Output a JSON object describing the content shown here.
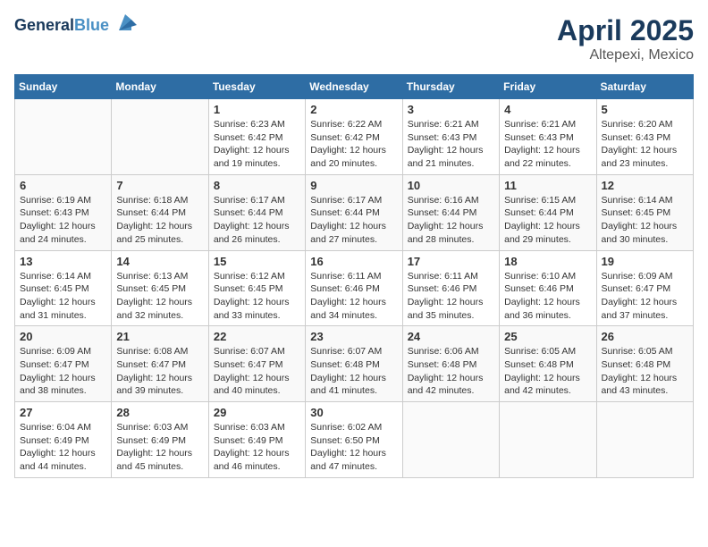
{
  "header": {
    "logo_line1": "General",
    "logo_line2": "Blue",
    "title": "April 2025",
    "subtitle": "Altepexi, Mexico"
  },
  "weekdays": [
    "Sunday",
    "Monday",
    "Tuesday",
    "Wednesday",
    "Thursday",
    "Friday",
    "Saturday"
  ],
  "weeks": [
    [
      {
        "day": "",
        "sunrise": "",
        "sunset": "",
        "daylight": ""
      },
      {
        "day": "",
        "sunrise": "",
        "sunset": "",
        "daylight": ""
      },
      {
        "day": "1",
        "sunrise": "Sunrise: 6:23 AM",
        "sunset": "Sunset: 6:42 PM",
        "daylight": "Daylight: 12 hours and 19 minutes."
      },
      {
        "day": "2",
        "sunrise": "Sunrise: 6:22 AM",
        "sunset": "Sunset: 6:42 PM",
        "daylight": "Daylight: 12 hours and 20 minutes."
      },
      {
        "day": "3",
        "sunrise": "Sunrise: 6:21 AM",
        "sunset": "Sunset: 6:43 PM",
        "daylight": "Daylight: 12 hours and 21 minutes."
      },
      {
        "day": "4",
        "sunrise": "Sunrise: 6:21 AM",
        "sunset": "Sunset: 6:43 PM",
        "daylight": "Daylight: 12 hours and 22 minutes."
      },
      {
        "day": "5",
        "sunrise": "Sunrise: 6:20 AM",
        "sunset": "Sunset: 6:43 PM",
        "daylight": "Daylight: 12 hours and 23 minutes."
      }
    ],
    [
      {
        "day": "6",
        "sunrise": "Sunrise: 6:19 AM",
        "sunset": "Sunset: 6:43 PM",
        "daylight": "Daylight: 12 hours and 24 minutes."
      },
      {
        "day": "7",
        "sunrise": "Sunrise: 6:18 AM",
        "sunset": "Sunset: 6:44 PM",
        "daylight": "Daylight: 12 hours and 25 minutes."
      },
      {
        "day": "8",
        "sunrise": "Sunrise: 6:17 AM",
        "sunset": "Sunset: 6:44 PM",
        "daylight": "Daylight: 12 hours and 26 minutes."
      },
      {
        "day": "9",
        "sunrise": "Sunrise: 6:17 AM",
        "sunset": "Sunset: 6:44 PM",
        "daylight": "Daylight: 12 hours and 27 minutes."
      },
      {
        "day": "10",
        "sunrise": "Sunrise: 6:16 AM",
        "sunset": "Sunset: 6:44 PM",
        "daylight": "Daylight: 12 hours and 28 minutes."
      },
      {
        "day": "11",
        "sunrise": "Sunrise: 6:15 AM",
        "sunset": "Sunset: 6:44 PM",
        "daylight": "Daylight: 12 hours and 29 minutes."
      },
      {
        "day": "12",
        "sunrise": "Sunrise: 6:14 AM",
        "sunset": "Sunset: 6:45 PM",
        "daylight": "Daylight: 12 hours and 30 minutes."
      }
    ],
    [
      {
        "day": "13",
        "sunrise": "Sunrise: 6:14 AM",
        "sunset": "Sunset: 6:45 PM",
        "daylight": "Daylight: 12 hours and 31 minutes."
      },
      {
        "day": "14",
        "sunrise": "Sunrise: 6:13 AM",
        "sunset": "Sunset: 6:45 PM",
        "daylight": "Daylight: 12 hours and 32 minutes."
      },
      {
        "day": "15",
        "sunrise": "Sunrise: 6:12 AM",
        "sunset": "Sunset: 6:45 PM",
        "daylight": "Daylight: 12 hours and 33 minutes."
      },
      {
        "day": "16",
        "sunrise": "Sunrise: 6:11 AM",
        "sunset": "Sunset: 6:46 PM",
        "daylight": "Daylight: 12 hours and 34 minutes."
      },
      {
        "day": "17",
        "sunrise": "Sunrise: 6:11 AM",
        "sunset": "Sunset: 6:46 PM",
        "daylight": "Daylight: 12 hours and 35 minutes."
      },
      {
        "day": "18",
        "sunrise": "Sunrise: 6:10 AM",
        "sunset": "Sunset: 6:46 PM",
        "daylight": "Daylight: 12 hours and 36 minutes."
      },
      {
        "day": "19",
        "sunrise": "Sunrise: 6:09 AM",
        "sunset": "Sunset: 6:47 PM",
        "daylight": "Daylight: 12 hours and 37 minutes."
      }
    ],
    [
      {
        "day": "20",
        "sunrise": "Sunrise: 6:09 AM",
        "sunset": "Sunset: 6:47 PM",
        "daylight": "Daylight: 12 hours and 38 minutes."
      },
      {
        "day": "21",
        "sunrise": "Sunrise: 6:08 AM",
        "sunset": "Sunset: 6:47 PM",
        "daylight": "Daylight: 12 hours and 39 minutes."
      },
      {
        "day": "22",
        "sunrise": "Sunrise: 6:07 AM",
        "sunset": "Sunset: 6:47 PM",
        "daylight": "Daylight: 12 hours and 40 minutes."
      },
      {
        "day": "23",
        "sunrise": "Sunrise: 6:07 AM",
        "sunset": "Sunset: 6:48 PM",
        "daylight": "Daylight: 12 hours and 41 minutes."
      },
      {
        "day": "24",
        "sunrise": "Sunrise: 6:06 AM",
        "sunset": "Sunset: 6:48 PM",
        "daylight": "Daylight: 12 hours and 42 minutes."
      },
      {
        "day": "25",
        "sunrise": "Sunrise: 6:05 AM",
        "sunset": "Sunset: 6:48 PM",
        "daylight": "Daylight: 12 hours and 42 minutes."
      },
      {
        "day": "26",
        "sunrise": "Sunrise: 6:05 AM",
        "sunset": "Sunset: 6:48 PM",
        "daylight": "Daylight: 12 hours and 43 minutes."
      }
    ],
    [
      {
        "day": "27",
        "sunrise": "Sunrise: 6:04 AM",
        "sunset": "Sunset: 6:49 PM",
        "daylight": "Daylight: 12 hours and 44 minutes."
      },
      {
        "day": "28",
        "sunrise": "Sunrise: 6:03 AM",
        "sunset": "Sunset: 6:49 PM",
        "daylight": "Daylight: 12 hours and 45 minutes."
      },
      {
        "day": "29",
        "sunrise": "Sunrise: 6:03 AM",
        "sunset": "Sunset: 6:49 PM",
        "daylight": "Daylight: 12 hours and 46 minutes."
      },
      {
        "day": "30",
        "sunrise": "Sunrise: 6:02 AM",
        "sunset": "Sunset: 6:50 PM",
        "daylight": "Daylight: 12 hours and 47 minutes."
      },
      {
        "day": "",
        "sunrise": "",
        "sunset": "",
        "daylight": ""
      },
      {
        "day": "",
        "sunrise": "",
        "sunset": "",
        "daylight": ""
      },
      {
        "day": "",
        "sunrise": "",
        "sunset": "",
        "daylight": ""
      }
    ]
  ]
}
